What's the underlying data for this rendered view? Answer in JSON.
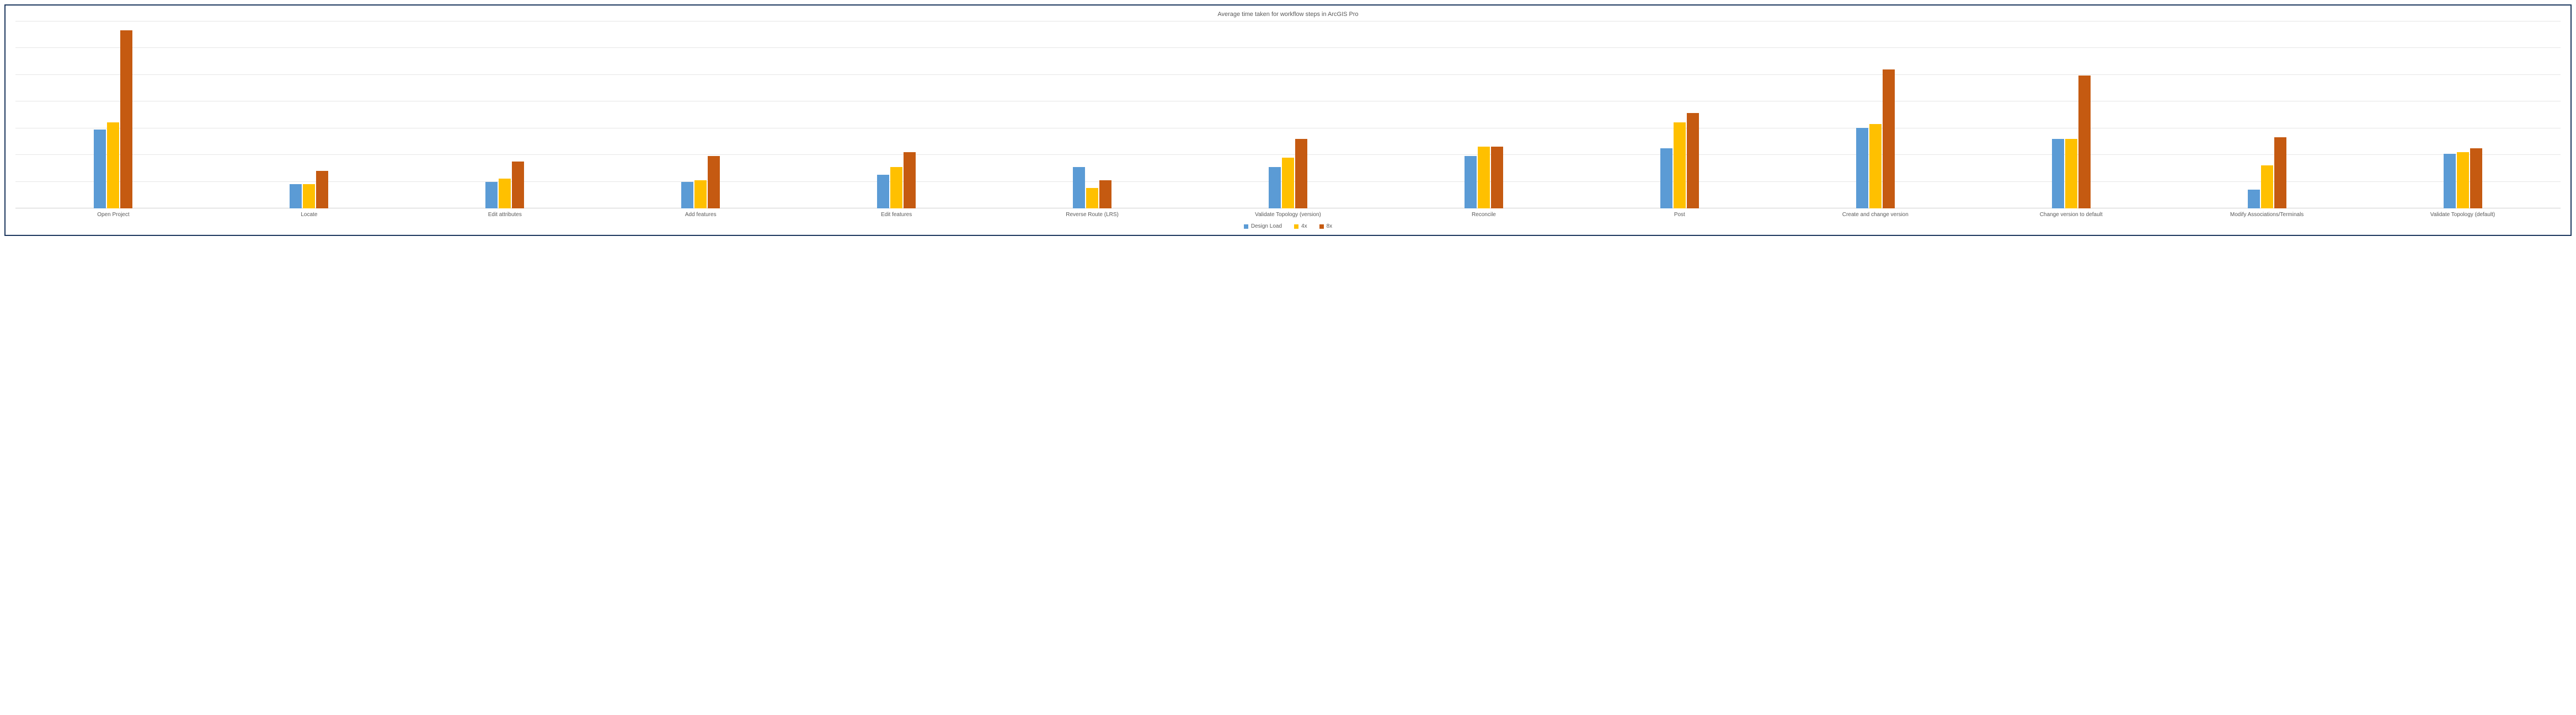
{
  "chart_data": {
    "type": "bar",
    "title": "Average time taken for workflow steps in ArcGIS Pro",
    "xlabel": "",
    "ylabel": "",
    "ylim": [
      0,
      100
    ],
    "grid": true,
    "legend_position": "bottom",
    "categories": [
      "Open Project",
      "Locate",
      "Edit attributes",
      "Add features",
      "Edit features",
      "Reverse Route (LRS)",
      "Validate Topology (version)",
      "Reconcile",
      "Post",
      "Create and change version",
      "Change version to default",
      "Modify Associations/Terminals",
      "Validate Topology (default)"
    ],
    "series": [
      {
        "name": "Design Load",
        "color": "#5b9bd5",
        "values": [
          42,
          13,
          14,
          14,
          18,
          22,
          22,
          28,
          32,
          43,
          37,
          10,
          29
        ]
      },
      {
        "name": "4x",
        "color": "#ffc000",
        "values": [
          46,
          13,
          16,
          15,
          22,
          11,
          27,
          33,
          46,
          45,
          37,
          23,
          30
        ]
      },
      {
        "name": "8x",
        "color": "#c55a11",
        "values": [
          95,
          20,
          25,
          28,
          30,
          15,
          37,
          33,
          51,
          74,
          71,
          38,
          32
        ]
      }
    ]
  }
}
